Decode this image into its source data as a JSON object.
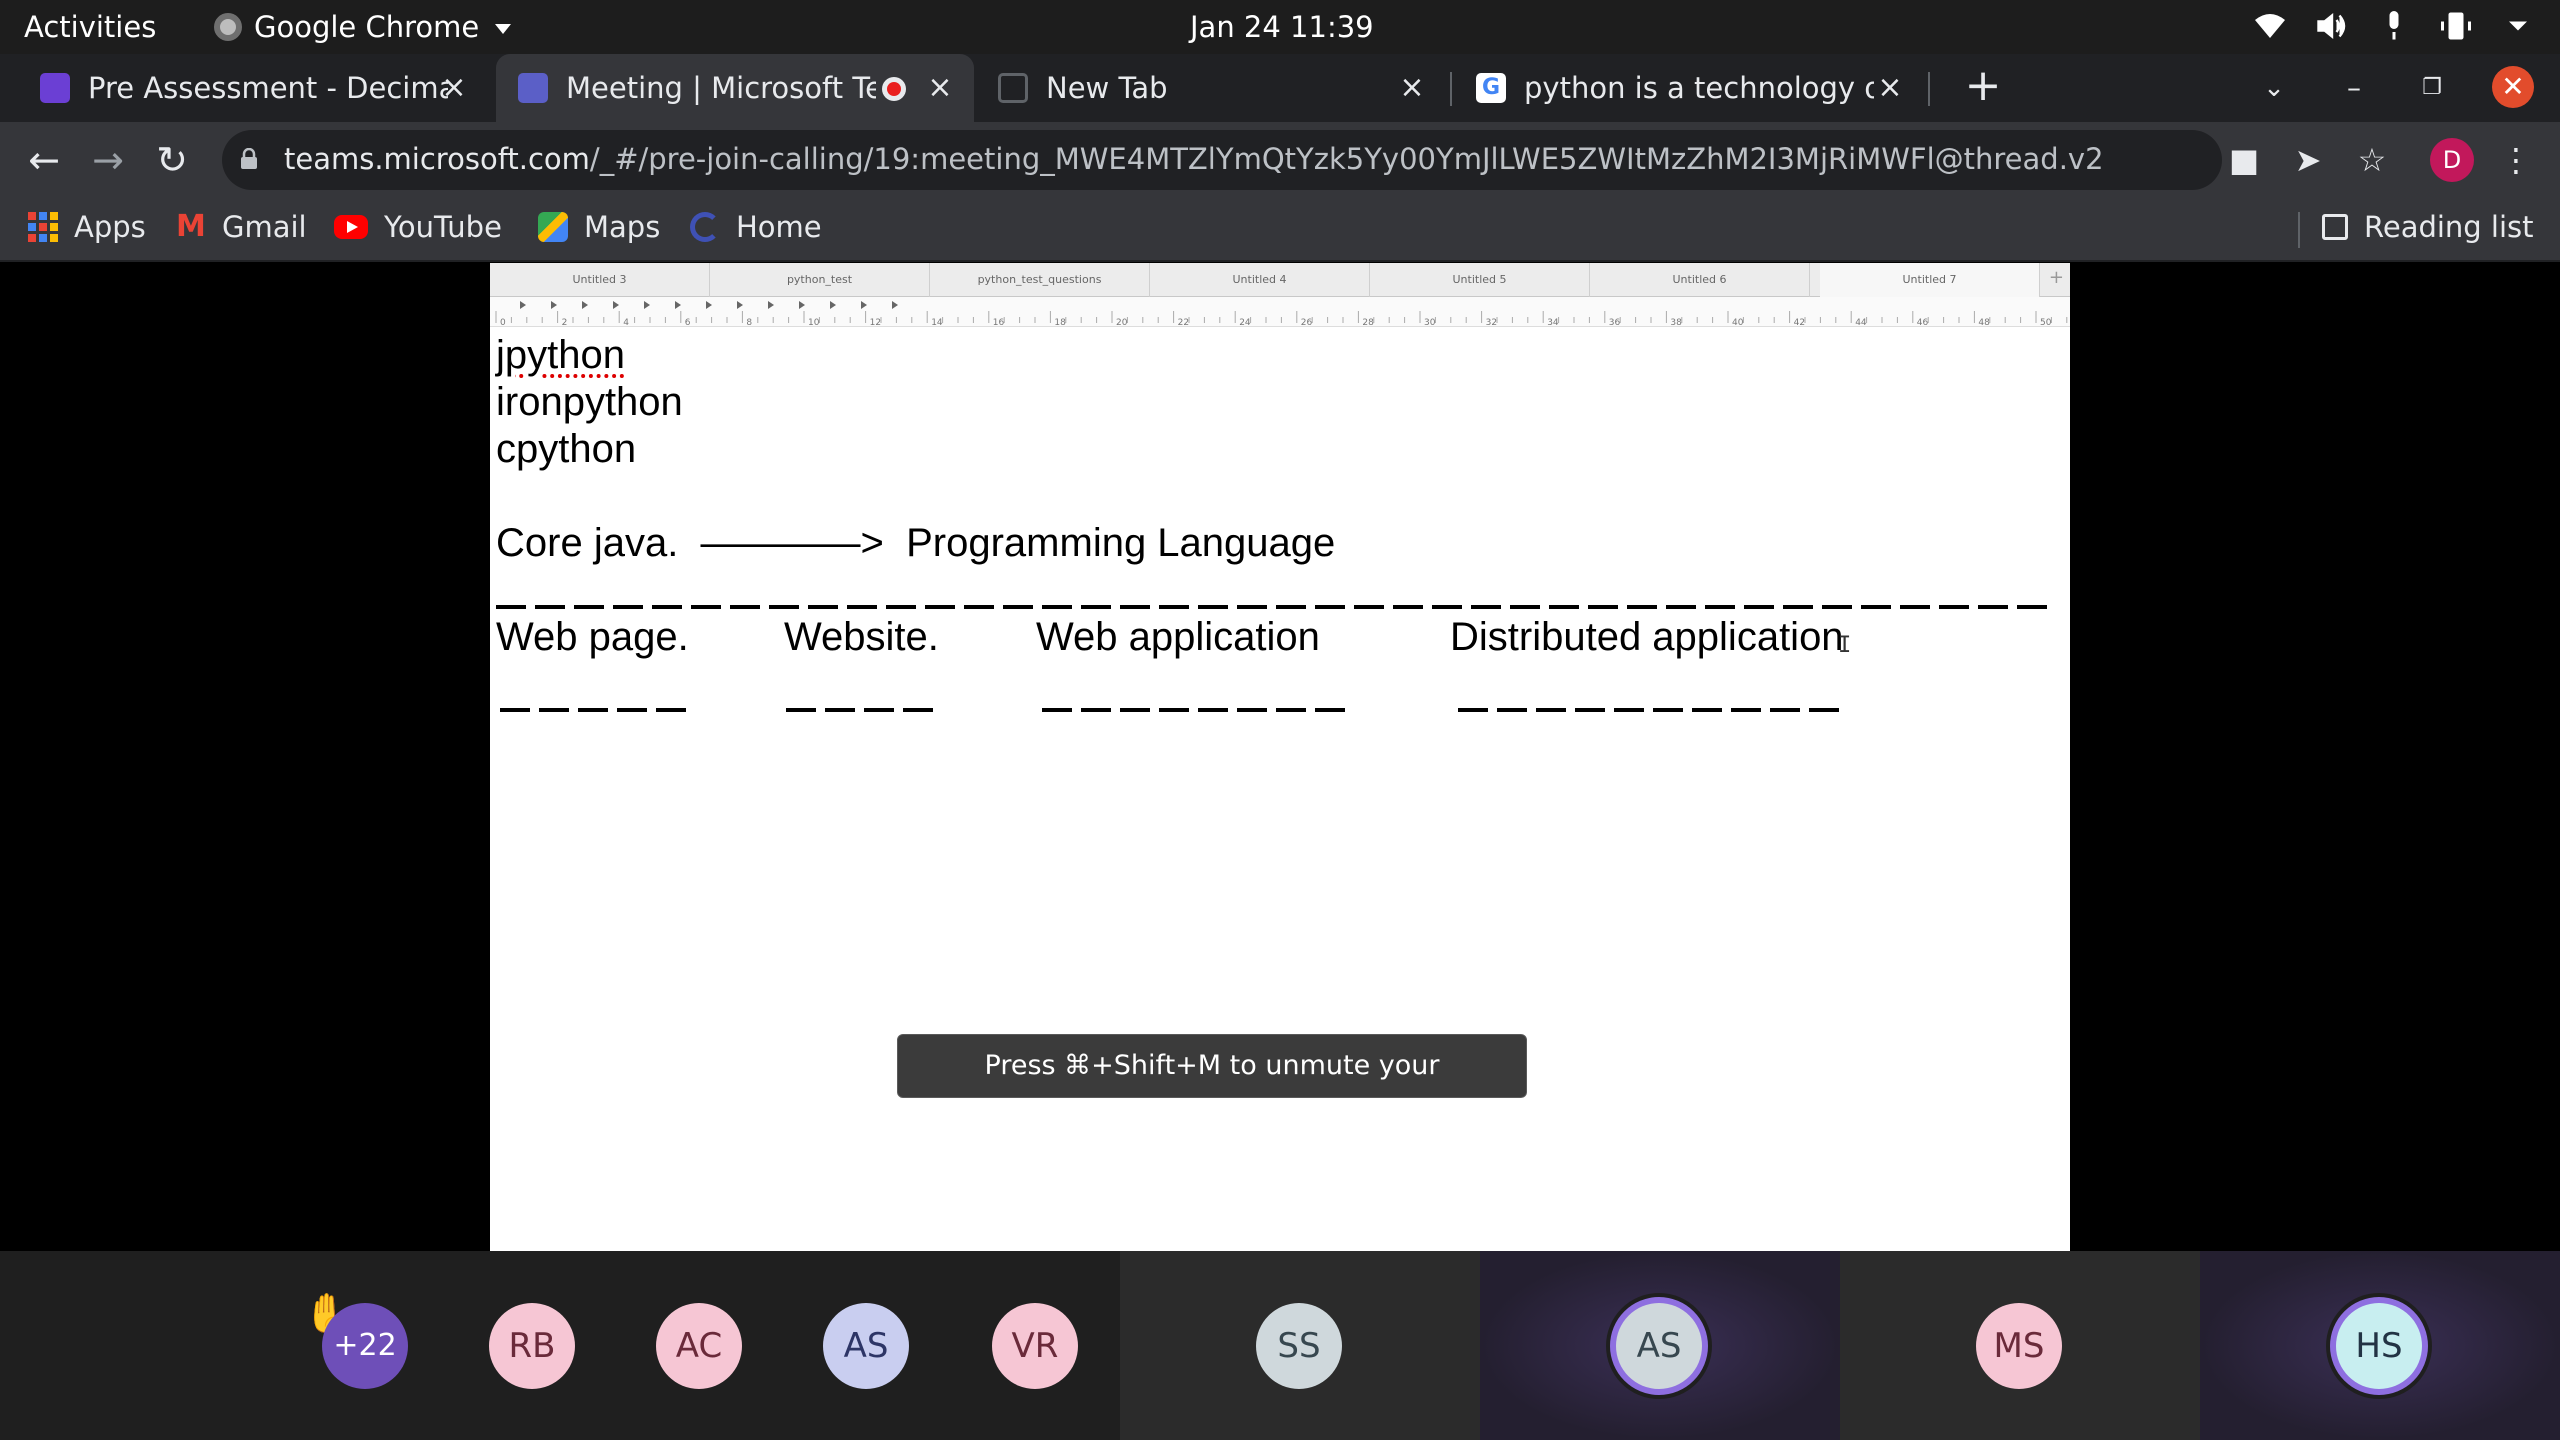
{
  "topbar": {
    "activities": "Activities",
    "app_name": "Google Chrome",
    "clock": "Jan 24  11:39"
  },
  "tabs": [
    {
      "title": "Pre Assessment - Decimal",
      "icon": "forms-icon",
      "active": false
    },
    {
      "title": "Meeting | Microsoft Te",
      "icon": "teams-icon",
      "active": true,
      "recording": true
    },
    {
      "title": "New Tab",
      "icon": "chrome-newtab-icon",
      "active": false
    },
    {
      "title": "python is a technology or",
      "icon": "google-icon",
      "active": false
    }
  ],
  "address_bar": {
    "host": "teams.microsoft.com",
    "path": "/_#/pre-join-calling/19:meeting_MWE4MTZlYmQtYzk5Yy00YmJlLWE5ZWItMzZhM2I3MjRiMWFl@thread.v2",
    "profile_initial": "D"
  },
  "bookmarks": [
    {
      "label": "Apps",
      "icon": "apps-grid-icon"
    },
    {
      "label": "Gmail",
      "icon": "gmail-icon"
    },
    {
      "label": "YouTube",
      "icon": "youtube-icon"
    },
    {
      "label": "Maps",
      "icon": "maps-icon"
    },
    {
      "label": "Home",
      "icon": "home-icon"
    }
  ],
  "reading_list": "Reading list",
  "doc_tabs": [
    "Untitled 3",
    "python_test",
    "python_test_questions",
    "Untitled 4",
    "Untitled 5",
    "Untitled 6",
    "Untitled 7"
  ],
  "ruler_labels": [
    "0",
    "2",
    "4",
    "6",
    "8",
    "10",
    "12",
    "14",
    "16",
    "18",
    "20",
    "22",
    "24",
    "26",
    "28",
    "30",
    "32",
    "34",
    "36",
    "38",
    "40",
    "42",
    "44",
    "46",
    "48",
    "50"
  ],
  "document": {
    "line1": "jpython",
    "line2": "ironpython",
    "line3": "cpython",
    "core_java": "Core java.  ————>  Programming Language",
    "web_page": "Web page.",
    "website": "Website.",
    "web_application": "Web application",
    "distributed_application": "Distributed application"
  },
  "toast": "Press ⌘+Shift+M to unmute your microphone.",
  "participants": [
    {
      "initials": "+22",
      "raised_hand": true
    },
    {
      "initials": "RB"
    },
    {
      "initials": "AC"
    },
    {
      "initials": "AS"
    },
    {
      "initials": "VR"
    },
    {
      "initials": "SS"
    },
    {
      "initials": "AS",
      "speaking": true
    },
    {
      "initials": "MS"
    },
    {
      "initials": "HS",
      "speaking": true
    }
  ],
  "colors": {
    "teams_purple": "#5b5fc7",
    "speaking_ring": "#8e6fe0",
    "chrome_dark": "#35363a"
  }
}
